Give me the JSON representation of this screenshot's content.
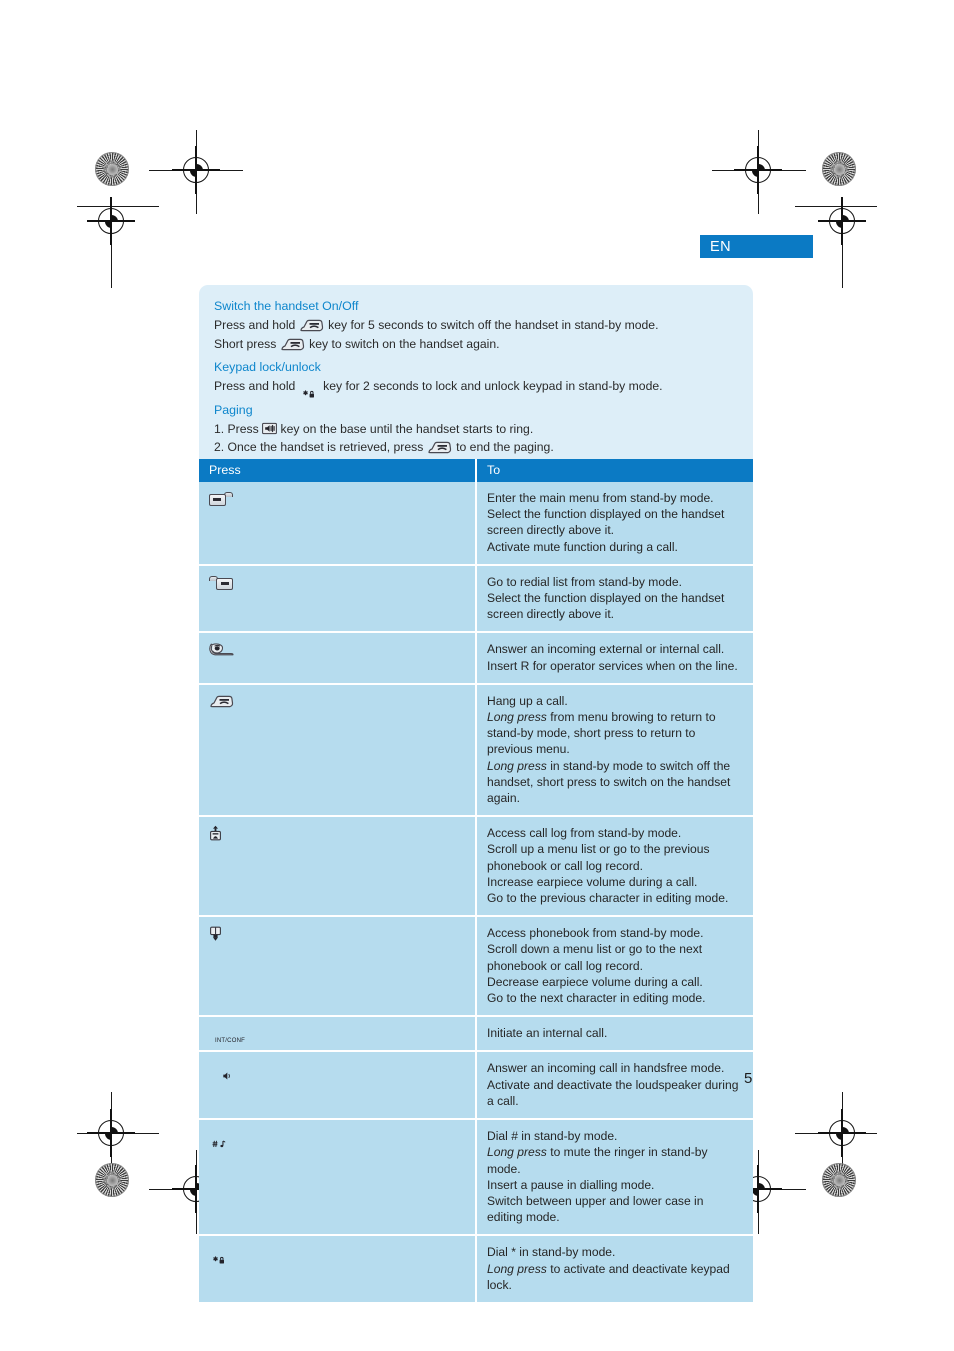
{
  "page": {
    "language_tab": "EN",
    "page_number": "5"
  },
  "info_box": {
    "sections": [
      {
        "heading": "Switch the handset On/Off",
        "lines": [
          {
            "pre": "Press and hold",
            "icon": "hangup-key-icon",
            "post": "key for 5 seconds to switch off the handset in stand-by mode."
          },
          {
            "pre": "Short press",
            "icon": "hangup-key-icon",
            "post": "key to switch on the handset again."
          }
        ]
      },
      {
        "heading": "Keypad lock/unlock",
        "lines": [
          {
            "pre": "Press and hold",
            "icon": "star-lock-key-icon",
            "post": "key for 2 seconds to lock and unlock keypad in stand-by mode."
          }
        ]
      },
      {
        "heading": "Paging",
        "lines": [
          {
            "pre": "1.  Press",
            "icon": "paging-key-icon",
            "post": "key on the base until the handset starts to ring."
          },
          {
            "pre": "2. Once the handset is retrieved, press",
            "icon": "hangup-key-icon",
            "post": "to end the paging."
          }
        ]
      }
    ]
  },
  "table": {
    "headers": {
      "press": "Press",
      "to": "To"
    },
    "rows": [
      {
        "icon": "soft-key-left-icon",
        "lines": [
          "Enter the main menu from stand-by mode.",
          "Select the function displayed on the handset screen directly above it.",
          "Activate mute function during a call."
        ]
      },
      {
        "icon": "soft-key-right-icon",
        "lines": [
          "Go to redial list from stand-by mode.",
          "Select the function displayed on the handset screen directly above it."
        ]
      },
      {
        "icon": "talk-key-icon",
        "lines": [
          "Answer an incoming external or internal call.",
          "Insert R for operator services when on the line."
        ]
      },
      {
        "icon": "hangup-key-icon",
        "lines": [
          "Hang up a call.",
          "Long press  from menu browing to return to stand-by mode, short press to return to previous menu.",
          "Long press in stand-by mode to switch off the handset, short press to switch on the handset again."
        ],
        "italic_prefix": [
          null,
          "Long press",
          "Long press"
        ]
      },
      {
        "icon": "nav-up-key-icon",
        "lines": [
          "Access call log from stand-by mode.",
          "Scroll up a menu list or go to the previous phonebook or call log record.",
          "Increase earpiece volume during a call.",
          "Go to the previous character in editing mode."
        ]
      },
      {
        "icon": "nav-down-key-icon",
        "lines": [
          "Access phonebook from stand-by mode.",
          "Scroll down a menu list or go to the next phonebook or call log record.",
          "Decrease earpiece volume during a call.",
          "Go to the next character in editing mode."
        ]
      },
      {
        "icon": "intercom-key-icon",
        "icon_label": "INT/CONF",
        "lines": [
          "Initiate an internal call."
        ]
      },
      {
        "icon": "speaker-key-icon",
        "lines": [
          "Answer an incoming call in handsfree mode.",
          "Activate and deactivate the loudspeaker during a call."
        ]
      },
      {
        "icon": "hash-ringer-key-icon",
        "lines": [
          "Dial # in stand-by mode.",
          "Long press to mute the ringer in stand-by mode.",
          "Insert a pause in dialling mode.",
          "Switch between upper and lower case in editing mode."
        ],
        "italic_prefix": [
          null,
          "Long press",
          null,
          null
        ]
      },
      {
        "icon": "star-lock-key-icon",
        "lines": [
          "Dial * in stand-by mode.",
          "Long press to activate and deactivate keypad lock."
        ],
        "italic_prefix": [
          null,
          "Long press"
        ]
      }
    ]
  },
  "colors": {
    "accent_blue": "#0b7ac4",
    "heading_blue": "#0e86cc",
    "info_box_bg": "#ddeef8",
    "table_row_bg": "#b6dcee"
  }
}
